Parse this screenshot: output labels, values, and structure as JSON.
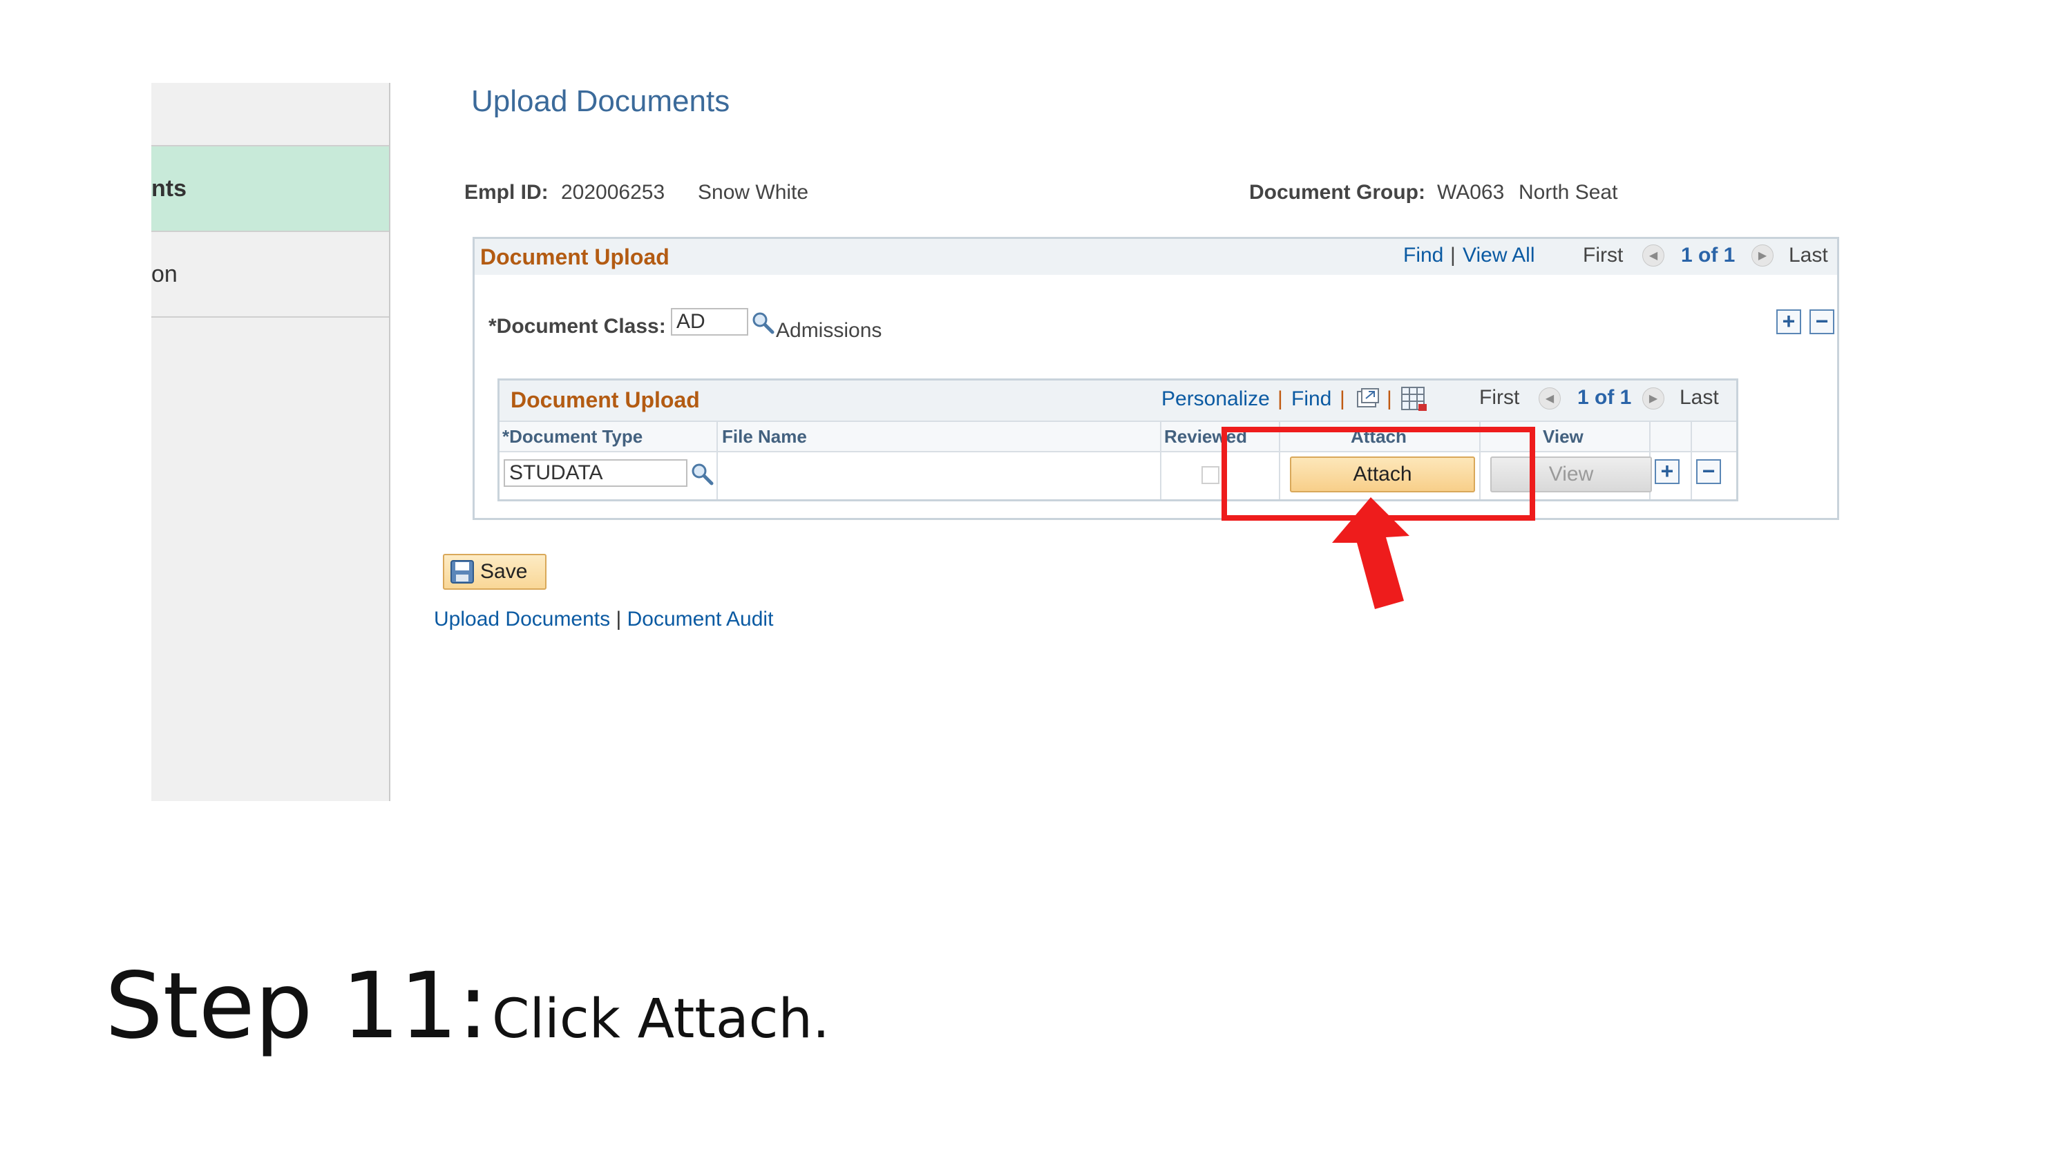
{
  "sidebar": {
    "items": [
      {
        "label": "nts",
        "active": true
      },
      {
        "label": "on",
        "active": false
      }
    ]
  },
  "page": {
    "title": "Upload Documents"
  },
  "employee": {
    "empl_id_label": "Empl ID:",
    "empl_id": "202006253",
    "name": "Snow White",
    "doc_group_label": "Document Group:",
    "doc_group_code": "WA063",
    "doc_group_name": "North Seat"
  },
  "outer_panel": {
    "title": "Document Upload",
    "find": "Find",
    "separator": "|",
    "view_all": "View All",
    "first": "First",
    "count": "1 of 1",
    "last": "Last",
    "document_class_label": "*Document Class:",
    "document_class_value": "AD",
    "document_class_desc": "Admissions"
  },
  "inner_grid": {
    "title": "Document Upload",
    "personalize": "Personalize",
    "find": "Find",
    "separator": "|",
    "first": "First",
    "count": "1 of 1",
    "last": "Last",
    "columns": [
      "*Document Type",
      "File Name",
      "Reviewed",
      "Attach",
      "View"
    ],
    "rows": [
      {
        "document_type": "STUDATA",
        "file_name": "",
        "reviewed": false,
        "attach_label": "Attach",
        "view_label": "View"
      }
    ]
  },
  "actions": {
    "save_label": "Save"
  },
  "footer": {
    "upload_documents": "Upload Documents",
    "separator": "|",
    "document_audit": "Document Audit"
  },
  "instruction": {
    "step": "Step 11:",
    "text": "Click Attach."
  },
  "colors": {
    "highlight": "#ee1c1c",
    "panel_title": "#b35b12",
    "link": "#0b5aa2",
    "nav_active": "#c8ead9"
  }
}
